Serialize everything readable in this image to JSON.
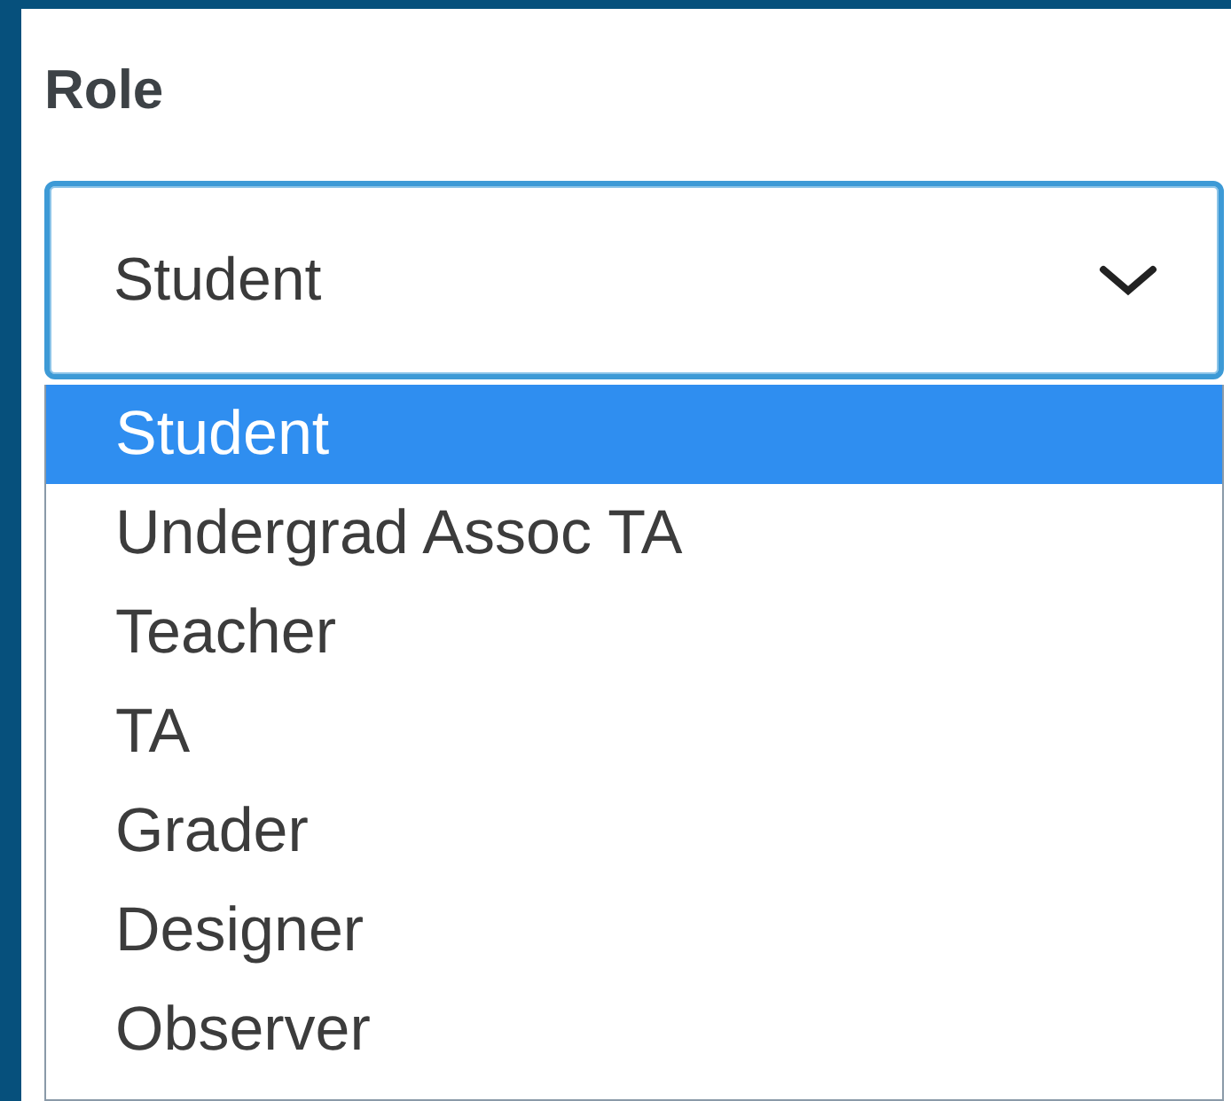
{
  "field": {
    "label": "Role",
    "value": "Student",
    "expanded": true
  },
  "options": [
    {
      "label": "Student",
      "selected": true
    },
    {
      "label": "Undergrad Assoc TA",
      "selected": false
    },
    {
      "label": "Teacher",
      "selected": false
    },
    {
      "label": "TA",
      "selected": false
    },
    {
      "label": "Grader",
      "selected": false
    },
    {
      "label": "Designer",
      "selected": false
    },
    {
      "label": "Observer",
      "selected": false
    }
  ]
}
